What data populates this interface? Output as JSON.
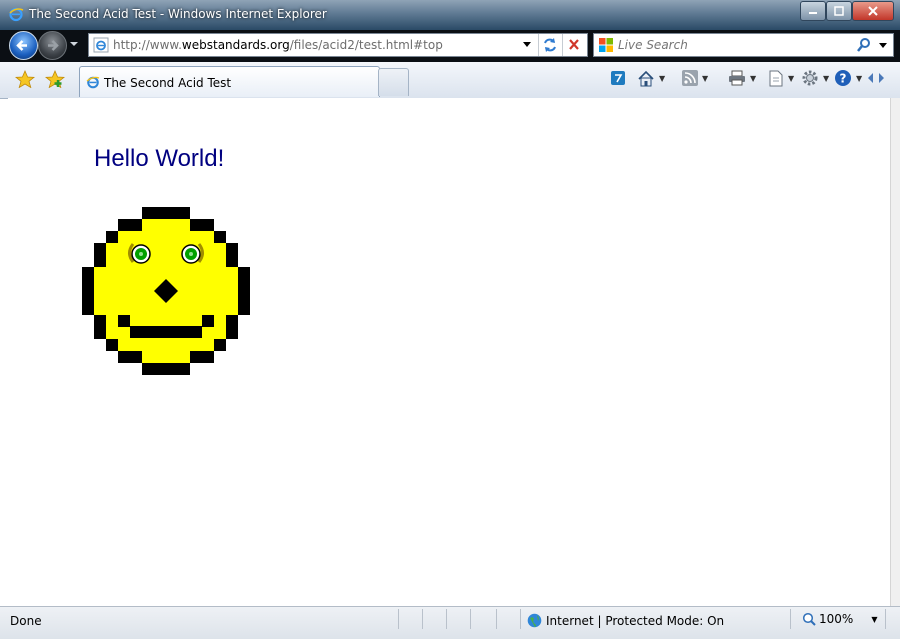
{
  "window": {
    "title": "The Second Acid Test - Windows Internet Explorer"
  },
  "address": {
    "url_prefix": "http://www.",
    "url_domain": "webstandards.org",
    "url_path": "/files/acid2/test.html#top"
  },
  "search": {
    "placeholder": "Live Search"
  },
  "tabs": [
    {
      "label": "The Second Acid Test"
    }
  ],
  "page": {
    "heading": "Hello World!"
  },
  "status": {
    "text": "Done",
    "zone": "Internet | Protected Mode: On",
    "zoom": "100%"
  },
  "colors": {
    "heading": "#000080",
    "face": "#ffff00",
    "outline": "#000000",
    "eyes": "#00a000"
  }
}
